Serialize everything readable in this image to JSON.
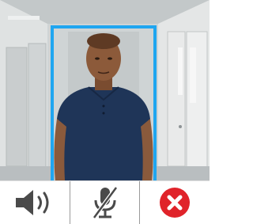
{
  "video": {
    "frame_color": "#1fa6f0",
    "subject": "person-in-hallway"
  },
  "controls": [
    {
      "name": "speaker-button",
      "icon": "speaker-icon",
      "state": "on",
      "color": "#4a4a4a"
    },
    {
      "name": "microphone-button",
      "icon": "microphone-muted-icon",
      "state": "muted",
      "color": "#4a4a4a"
    },
    {
      "name": "end-call-button",
      "icon": "close-circle-icon",
      "color": "#e0232a"
    }
  ]
}
